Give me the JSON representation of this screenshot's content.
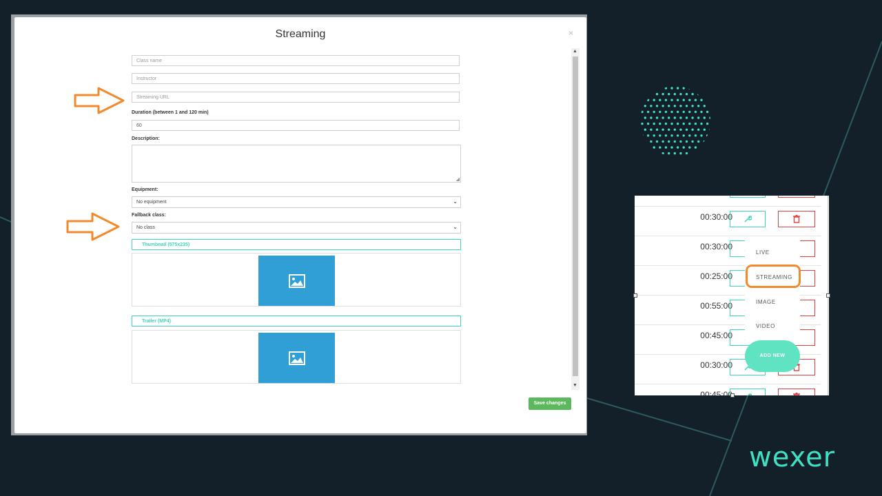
{
  "modal": {
    "title": "Streaming",
    "close": "×",
    "fields": {
      "class_name_placeholder": "Class name",
      "instructor_placeholder": "Instructor",
      "streaming_url_placeholder": "Streaming URL",
      "duration_label": "Duration (between 1 and 120 min)",
      "duration_value": "60",
      "description_label": "Description:",
      "equipment_label": "Equipment:",
      "equipment_value": "No equipment",
      "fallback_label": "Fallback class:",
      "fallback_value": "No class"
    },
    "thumbnail_tab": "Thumbnail (575x235)",
    "trailer_tab": "Trailer (MP4)",
    "save_button": "Save changes"
  },
  "colors": {
    "accent": "#3dd6b8",
    "arrow": "#f08a2c",
    "save": "#5cb85c",
    "image_placeholder": "#2f9fd6",
    "delete": "#e04040",
    "background": "#13202a"
  },
  "panel": {
    "rows": [
      {
        "time": ""
      },
      {
        "time": "00:30:00"
      },
      {
        "time": "00:30:00"
      },
      {
        "time": "00:25:00"
      },
      {
        "time": "00:55:00"
      },
      {
        "time": "00:45:00"
      },
      {
        "time": "00:30:00"
      },
      {
        "time": "00:45:00"
      }
    ],
    "menu": [
      "LIVE",
      "STREAMING",
      "IMAGE",
      "VIDEO"
    ],
    "add_new": "ADD NEW"
  },
  "brand": {
    "logo": "wexer"
  }
}
